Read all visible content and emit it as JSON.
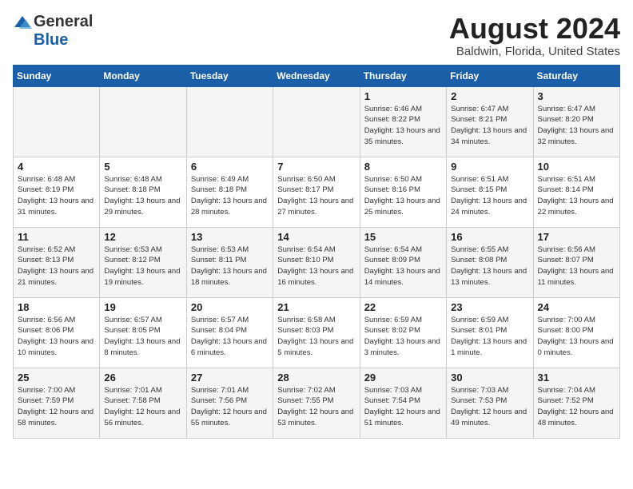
{
  "header": {
    "logo_general": "General",
    "logo_blue": "Blue",
    "month_title": "August 2024",
    "location": "Baldwin, Florida, United States"
  },
  "days_of_week": [
    "Sunday",
    "Monday",
    "Tuesday",
    "Wednesday",
    "Thursday",
    "Friday",
    "Saturday"
  ],
  "weeks": [
    [
      {
        "day": "",
        "sunrise": "",
        "sunset": "",
        "daylight": ""
      },
      {
        "day": "",
        "sunrise": "",
        "sunset": "",
        "daylight": ""
      },
      {
        "day": "",
        "sunrise": "",
        "sunset": "",
        "daylight": ""
      },
      {
        "day": "",
        "sunrise": "",
        "sunset": "",
        "daylight": ""
      },
      {
        "day": "1",
        "sunrise": "6:46 AM",
        "sunset": "8:22 PM",
        "daylight": "13 hours and 35 minutes."
      },
      {
        "day": "2",
        "sunrise": "6:47 AM",
        "sunset": "8:21 PM",
        "daylight": "13 hours and 34 minutes."
      },
      {
        "day": "3",
        "sunrise": "6:47 AM",
        "sunset": "8:20 PM",
        "daylight": "13 hours and 32 minutes."
      }
    ],
    [
      {
        "day": "4",
        "sunrise": "6:48 AM",
        "sunset": "8:19 PM",
        "daylight": "13 hours and 31 minutes."
      },
      {
        "day": "5",
        "sunrise": "6:48 AM",
        "sunset": "8:18 PM",
        "daylight": "13 hours and 29 minutes."
      },
      {
        "day": "6",
        "sunrise": "6:49 AM",
        "sunset": "8:18 PM",
        "daylight": "13 hours and 28 minutes."
      },
      {
        "day": "7",
        "sunrise": "6:50 AM",
        "sunset": "8:17 PM",
        "daylight": "13 hours and 27 minutes."
      },
      {
        "day": "8",
        "sunrise": "6:50 AM",
        "sunset": "8:16 PM",
        "daylight": "13 hours and 25 minutes."
      },
      {
        "day": "9",
        "sunrise": "6:51 AM",
        "sunset": "8:15 PM",
        "daylight": "13 hours and 24 minutes."
      },
      {
        "day": "10",
        "sunrise": "6:51 AM",
        "sunset": "8:14 PM",
        "daylight": "13 hours and 22 minutes."
      }
    ],
    [
      {
        "day": "11",
        "sunrise": "6:52 AM",
        "sunset": "8:13 PM",
        "daylight": "13 hours and 21 minutes."
      },
      {
        "day": "12",
        "sunrise": "6:53 AM",
        "sunset": "8:12 PM",
        "daylight": "13 hours and 19 minutes."
      },
      {
        "day": "13",
        "sunrise": "6:53 AM",
        "sunset": "8:11 PM",
        "daylight": "13 hours and 18 minutes."
      },
      {
        "day": "14",
        "sunrise": "6:54 AM",
        "sunset": "8:10 PM",
        "daylight": "13 hours and 16 minutes."
      },
      {
        "day": "15",
        "sunrise": "6:54 AM",
        "sunset": "8:09 PM",
        "daylight": "13 hours and 14 minutes."
      },
      {
        "day": "16",
        "sunrise": "6:55 AM",
        "sunset": "8:08 PM",
        "daylight": "13 hours and 13 minutes."
      },
      {
        "day": "17",
        "sunrise": "6:56 AM",
        "sunset": "8:07 PM",
        "daylight": "13 hours and 11 minutes."
      }
    ],
    [
      {
        "day": "18",
        "sunrise": "6:56 AM",
        "sunset": "8:06 PM",
        "daylight": "13 hours and 10 minutes."
      },
      {
        "day": "19",
        "sunrise": "6:57 AM",
        "sunset": "8:05 PM",
        "daylight": "13 hours and 8 minutes."
      },
      {
        "day": "20",
        "sunrise": "6:57 AM",
        "sunset": "8:04 PM",
        "daylight": "13 hours and 6 minutes."
      },
      {
        "day": "21",
        "sunrise": "6:58 AM",
        "sunset": "8:03 PM",
        "daylight": "13 hours and 5 minutes."
      },
      {
        "day": "22",
        "sunrise": "6:59 AM",
        "sunset": "8:02 PM",
        "daylight": "13 hours and 3 minutes."
      },
      {
        "day": "23",
        "sunrise": "6:59 AM",
        "sunset": "8:01 PM",
        "daylight": "13 hours and 1 minute."
      },
      {
        "day": "24",
        "sunrise": "7:00 AM",
        "sunset": "8:00 PM",
        "daylight": "13 hours and 0 minutes."
      }
    ],
    [
      {
        "day": "25",
        "sunrise": "7:00 AM",
        "sunset": "7:59 PM",
        "daylight": "12 hours and 58 minutes."
      },
      {
        "day": "26",
        "sunrise": "7:01 AM",
        "sunset": "7:58 PM",
        "daylight": "12 hours and 56 minutes."
      },
      {
        "day": "27",
        "sunrise": "7:01 AM",
        "sunset": "7:56 PM",
        "daylight": "12 hours and 55 minutes."
      },
      {
        "day": "28",
        "sunrise": "7:02 AM",
        "sunset": "7:55 PM",
        "daylight": "12 hours and 53 minutes."
      },
      {
        "day": "29",
        "sunrise": "7:03 AM",
        "sunset": "7:54 PM",
        "daylight": "12 hours and 51 minutes."
      },
      {
        "day": "30",
        "sunrise": "7:03 AM",
        "sunset": "7:53 PM",
        "daylight": "12 hours and 49 minutes."
      },
      {
        "day": "31",
        "sunrise": "7:04 AM",
        "sunset": "7:52 PM",
        "daylight": "12 hours and 48 minutes."
      }
    ]
  ],
  "labels": {
    "sunrise_prefix": "Sunrise: ",
    "sunset_prefix": "Sunset: ",
    "daylight_prefix": "Daylight: "
  }
}
